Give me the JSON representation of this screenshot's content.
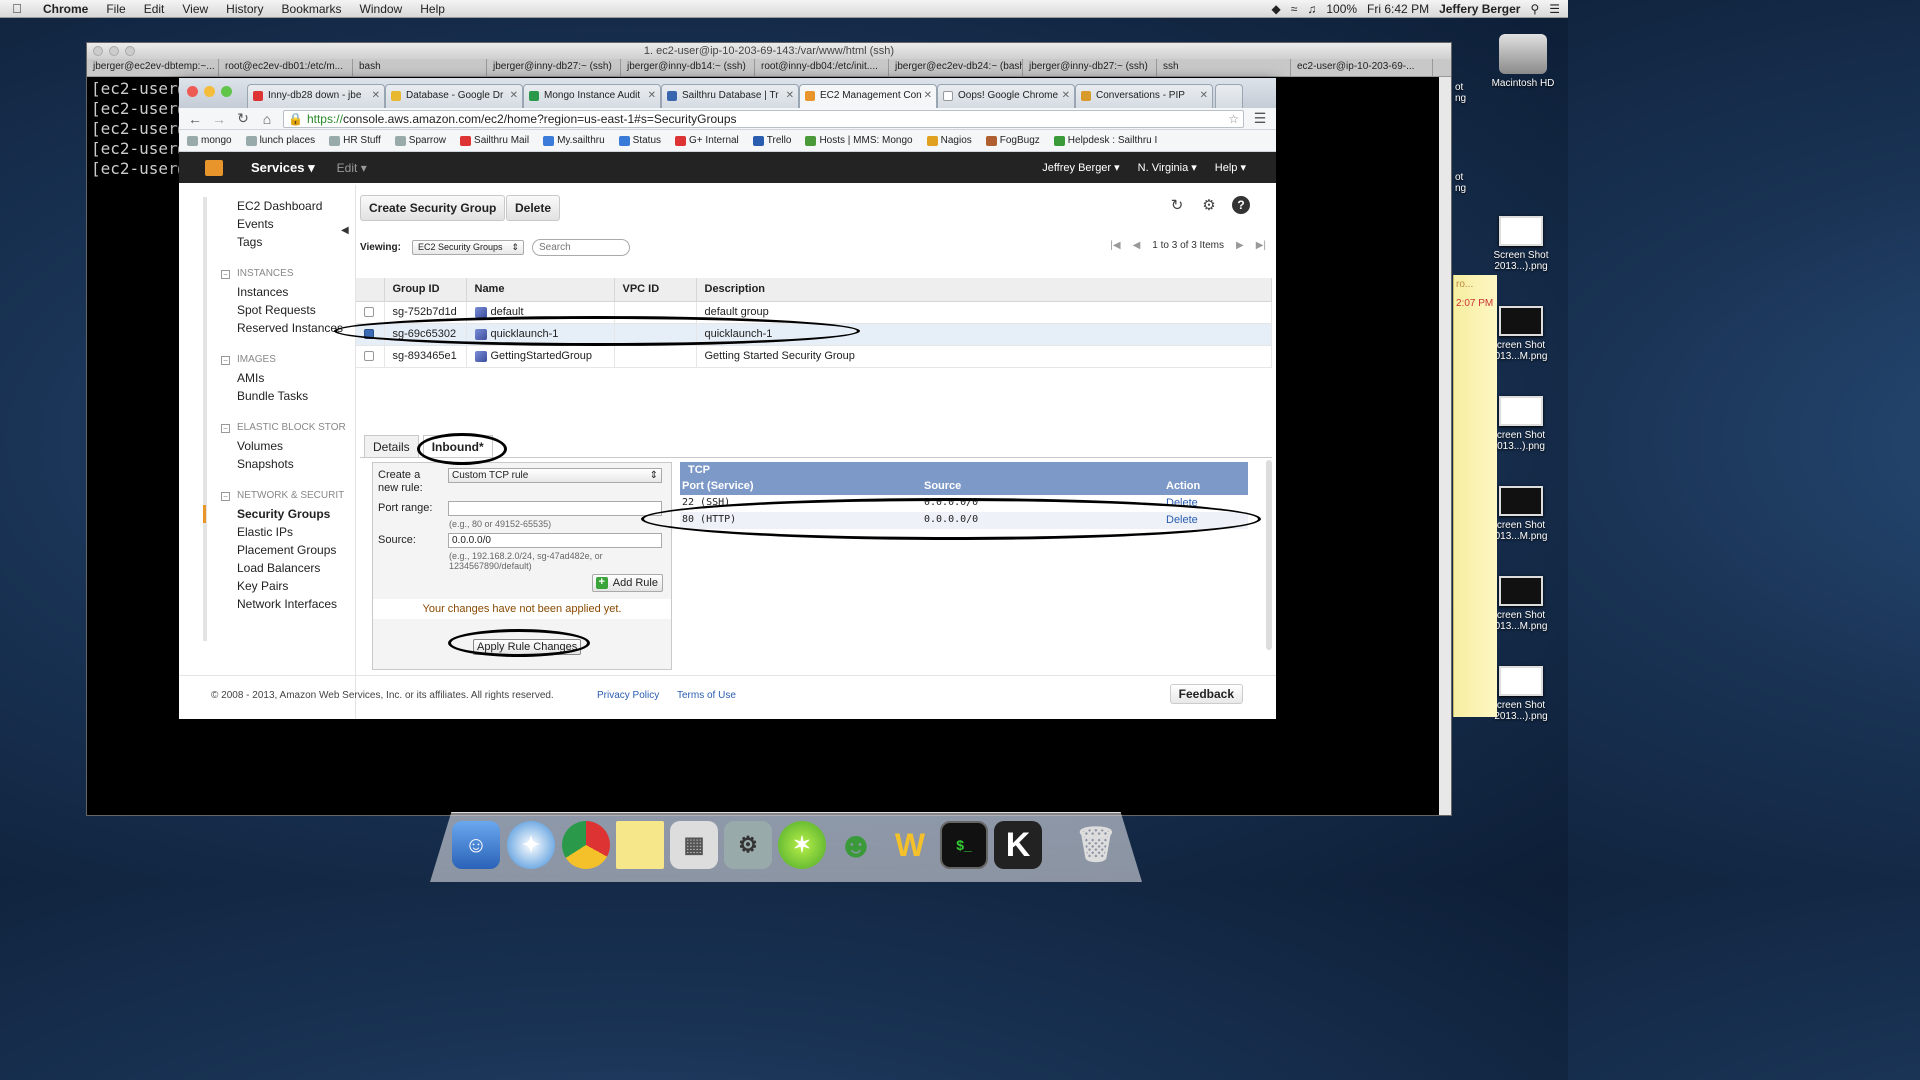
{
  "menubar": {
    "app": "Chrome",
    "items": [
      "File",
      "Edit",
      "View",
      "History",
      "Bookmarks",
      "Window",
      "Help"
    ],
    "battery": "100%",
    "clock": "Fri 6:42 PM",
    "user": "Jeffery Berger"
  },
  "terminal": {
    "title": "1. ec2-user@ip-10-203-69-143:/var/www/html (ssh)",
    "tabs": [
      "jberger@ec2ev-dbtemp:~...",
      "root@ec2ev-db01:/etc/m...",
      "bash",
      "jberger@inny-db27:~ (ssh)",
      "jberger@inny-db14:~ (ssh)",
      "root@inny-db04:/etc/init....",
      "jberger@ec2ev-db24:~ (bash)",
      "jberger@inny-db27:~ (ssh)",
      "ssh",
      "ec2-user@ip-10-203-69-..."
    ],
    "lines": [
      "[ec2-user@",
      "[ec2-user@",
      "[ec2-user@",
      "[ec2-user@",
      "[ec2-user@"
    ]
  },
  "desktop": {
    "hd": "Macintosh HD",
    "shots": [
      "Screen Shot 2013...).png",
      "creen Shot 013...M.png",
      "creen Shot 013...).png",
      "creen Shot 013...M.png",
      "creen Shot 013...M.png",
      "creen Shot 2013...).png"
    ],
    "partial": [
      "ot ng",
      "ot ng"
    ],
    "sticky_time": "2:07 PM",
    "sticky_text": "ro..."
  },
  "browser": {
    "tabs": [
      "Inny-db28 down - jbe",
      "Database - Google Dr",
      "Mongo Instance Audit",
      "Sailthru Database | Tr",
      "EC2 Management Con",
      "Oops! Google Chrome",
      "Conversations - PIP"
    ],
    "url_scheme": "https://",
    "url_rest": "console.aws.amazon.com/ec2/home?region=us-east-1#s=SecurityGroups",
    "bookmarks": [
      "mongo",
      "lunch places",
      "HR Stuff",
      "Sparrow",
      "Sailthru Mail",
      "My.sailthru",
      "Status",
      "G+ Internal",
      "Trello",
      "Hosts | MMS: Mongo",
      "Nagios",
      "FogBugz",
      "Helpdesk : Sailthru I"
    ]
  },
  "aws": {
    "services": "Services",
    "edit": "Edit",
    "user": "Jeffrey Berger",
    "region": "N. Virginia",
    "help": "Help"
  },
  "nav": {
    "top": [
      "EC2 Dashboard",
      "Events",
      "Tags"
    ],
    "sections": [
      {
        "title": "INSTANCES",
        "items": [
          "Instances",
          "Spot Requests",
          "Reserved Instances"
        ]
      },
      {
        "title": "IMAGES",
        "items": [
          "AMIs",
          "Bundle Tasks"
        ]
      },
      {
        "title": "ELASTIC BLOCK STOR",
        "items": [
          "Volumes",
          "Snapshots"
        ]
      },
      {
        "title": "NETWORK & SECURIT",
        "items": [
          "Security Groups",
          "Elastic IPs",
          "Placement Groups",
          "Load Balancers",
          "Key Pairs",
          "Network Interfaces"
        ]
      }
    ]
  },
  "toolbar": {
    "create": "Create Security Group",
    "delete": "Delete",
    "viewing_label": "Viewing:",
    "viewing_value": "EC2 Security Groups",
    "search_placeholder": "Search",
    "pager": "1 to 3 of 3 Items"
  },
  "table": {
    "headers": [
      "Group ID",
      "Name",
      "VPC ID",
      "Description"
    ],
    "rows": [
      {
        "id": "sg-752b7d1d",
        "name": "default",
        "vpc": "",
        "desc": "default group",
        "checked": false
      },
      {
        "id": "sg-69c65302",
        "name": "quicklaunch-1",
        "vpc": "",
        "desc": "quicklaunch-1",
        "checked": true
      },
      {
        "id": "sg-893465e1",
        "name": "GettingStartedGroup",
        "vpc": "",
        "desc": "Getting Started Security Group",
        "checked": false
      }
    ]
  },
  "details": {
    "tabs": [
      "Details",
      "Inbound*"
    ],
    "create_label_1": "Create a",
    "create_label_2": "new rule:",
    "rule_type": "Custom TCP rule",
    "port_label": "Port range:",
    "port_value": "",
    "port_hint": "(e.g., 80 or 49152-65535)",
    "source_label": "Source:",
    "source_value": "0.0.0.0/0",
    "source_hint_1": "(e.g., 192.168.2.0/24, sg-47ad482e, or",
    "source_hint_2": "1234567890/default)",
    "add_rule": "Add Rule",
    "warning": "Your changes have not been applied yet.",
    "apply": "Apply Rule Changes"
  },
  "rules": {
    "protocol": "TCP",
    "headers": [
      "Port (Service)",
      "Source",
      "Action"
    ],
    "rows": [
      {
        "port": "22 (SSH)",
        "source": "0.0.0.0/0",
        "action": "Delete"
      },
      {
        "port": "80 (HTTP)",
        "source": "0.0.0.0/0",
        "action": "Delete"
      }
    ]
  },
  "footer": {
    "copyright": "© 2008 - 2013, Amazon Web Services, Inc. or its affiliates. All rights reserved.",
    "privacy": "Privacy Policy",
    "terms": "Terms of Use",
    "feedback": "Feedback"
  }
}
